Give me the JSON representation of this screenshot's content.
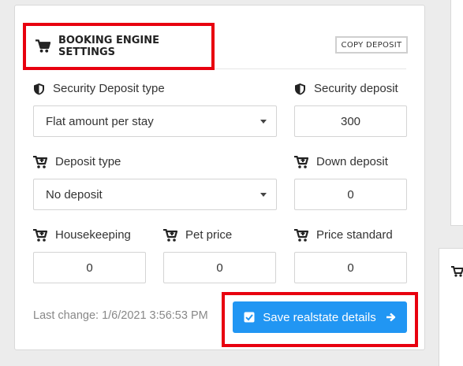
{
  "header": {
    "title": "BOOKING ENGINE SETTINGS",
    "copy_button": "COPY DEPOSIT"
  },
  "fields": {
    "security_deposit_type": {
      "label": "Security Deposit type",
      "value": "Flat amount per stay"
    },
    "security_deposit": {
      "label": "Security deposit",
      "value": "300"
    },
    "deposit_type": {
      "label": "Deposit type",
      "value": "No deposit"
    },
    "down_deposit": {
      "label": "Down deposit",
      "value": "0"
    },
    "housekeeping": {
      "label": "Housekeeping",
      "value": "0"
    },
    "pet_price": {
      "label": "Pet price",
      "value": "0"
    },
    "price_standard": {
      "label": "Price standard",
      "value": "0"
    }
  },
  "footer": {
    "last_change": "Last change: 1/6/2021 3:56:53 PM",
    "save_button": "Save realstate details"
  },
  "colors": {
    "accent": "#2196f3",
    "highlight": "#e8000f"
  },
  "icons": {
    "header": "cart-icon",
    "security": "shield-icon",
    "cart": "cart-plus-icon",
    "save_check": "checkbox-icon",
    "save_arrow": "arrow-right-icon"
  }
}
